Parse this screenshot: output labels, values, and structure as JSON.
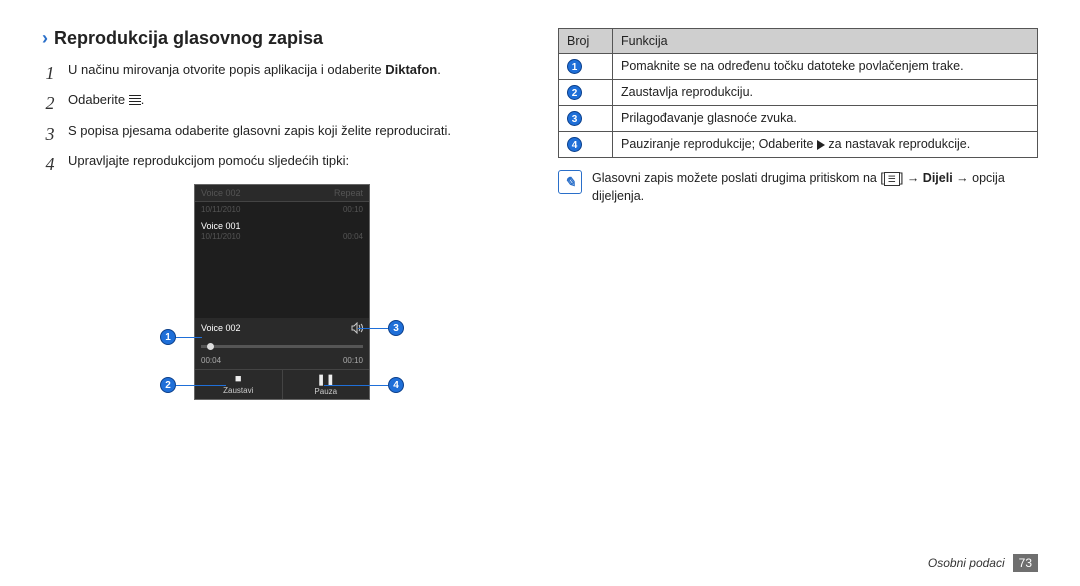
{
  "heading": "Reprodukcija glasovnog zapisa",
  "steps": [
    {
      "n": "1",
      "pre": "U načinu mirovanja otvorite popis aplikacija i odaberite ",
      "bold": "Diktafon",
      "post": "."
    },
    {
      "n": "2",
      "pre": "Odaberite ",
      "icon": "list",
      "post": "."
    },
    {
      "n": "3",
      "pre": "S popisa pjesama odaberite glasovni zapis koji želite reproducirati."
    },
    {
      "n": "4",
      "pre": "Upravljajte reprodukcijom pomoću sljedećih tipki:"
    }
  ],
  "phone": {
    "header": {
      "left": "Voice 002",
      "right": "Repeat"
    },
    "headerSub": {
      "left": "10/11/2010",
      "right": "00:10"
    },
    "listItem": {
      "title": "Voice 001",
      "subLeft": "10/11/2010",
      "subRight": "00:04"
    },
    "np": {
      "title": "Voice 002",
      "t1": "00:04",
      "t2": "00:10",
      "btn1": "Zaustavi",
      "btn2": "Pauza"
    }
  },
  "table": {
    "h1": "Broj",
    "h2": "Funkcija",
    "rows": [
      {
        "n": "1",
        "text": "Pomaknite se na određenu točku datoteke povlačenjem trake."
      },
      {
        "n": "2",
        "text": "Zaustavlja reprodukciju."
      },
      {
        "n": "3",
        "text": "Prilagođavanje glasnoće zvuka."
      },
      {
        "n": "4",
        "pre": "Pauziranje reprodukcije; Odaberite ",
        "post": " za nastavak reprodukcije."
      }
    ]
  },
  "note": {
    "pre": "Glasovni zapis možete poslati drugima pritiskom na [",
    "mid": "] → ",
    "bold": "Dijeli",
    "post": " → opcija dijeljenja."
  },
  "footer": {
    "section": "Osobni podaci",
    "page": "73"
  }
}
